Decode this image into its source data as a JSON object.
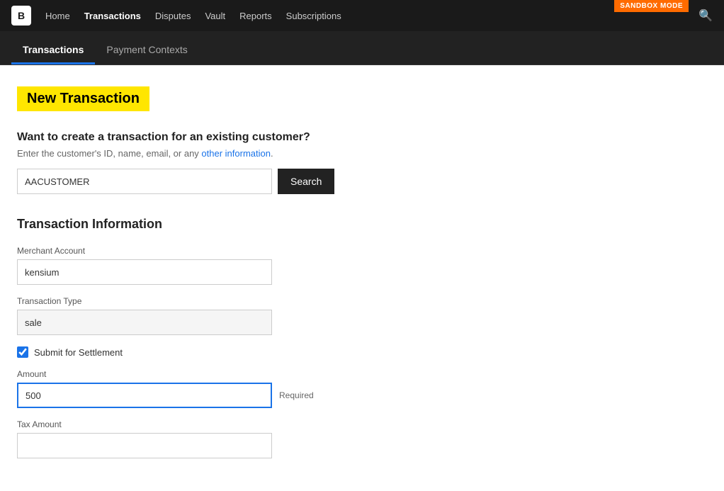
{
  "brand": {
    "logo_text": "B"
  },
  "sandbox_badge": "SANDBOX MODE",
  "nav": {
    "links": [
      {
        "label": "Home",
        "active": false
      },
      {
        "label": "Transactions",
        "active": true
      },
      {
        "label": "Disputes",
        "active": false
      },
      {
        "label": "Vault",
        "active": false
      },
      {
        "label": "Reports",
        "active": false
      },
      {
        "label": "Subscriptions",
        "active": false
      }
    ]
  },
  "sub_tabs": [
    {
      "label": "Transactions",
      "active": true
    },
    {
      "label": "Payment Contexts",
      "active": false
    }
  ],
  "page_title": "New Transaction",
  "customer_section": {
    "heading": "Want to create a transaction for an existing customer?",
    "hint_text": "Enter the customer's ID, name, email, or any ",
    "hint_link": "other information",
    "hint_end": ".",
    "search_placeholder": "",
    "search_value": "AACUSTOMER",
    "search_button_label": "Search"
  },
  "transaction_section": {
    "title": "Transaction Information",
    "merchant_account_label": "Merchant Account",
    "merchant_account_value": "kensium",
    "transaction_type_label": "Transaction Type",
    "transaction_type_value": "sale",
    "submit_settlement_label": "Submit for Settlement",
    "submit_settlement_checked": true,
    "amount_label": "Amount",
    "amount_value": "500",
    "amount_required_label": "Required",
    "tax_amount_label": "Tax Amount"
  }
}
